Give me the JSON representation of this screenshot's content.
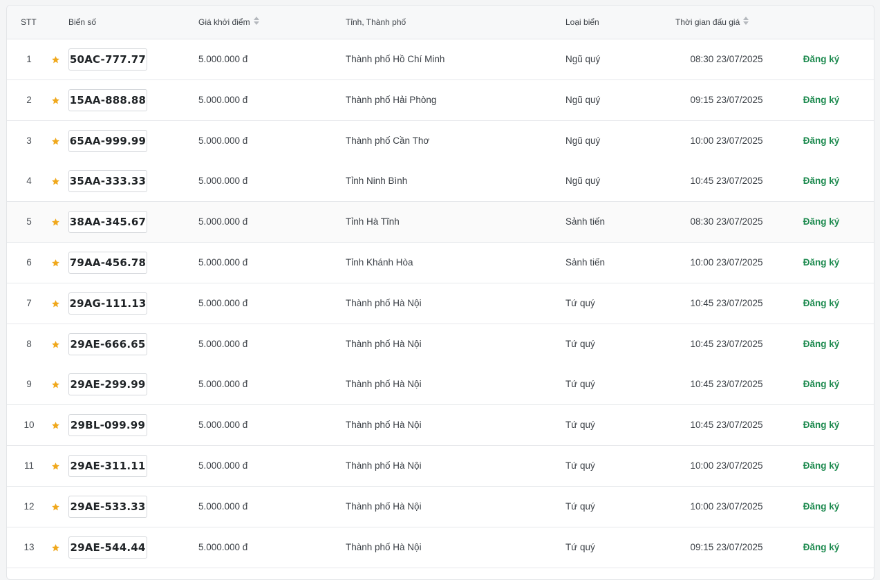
{
  "header": {
    "stt": "STT",
    "plate": "Biển số",
    "price": "Giá khởi điểm",
    "province": "Tỉnh, Thành phố",
    "type": "Loại biển",
    "time": "Thời gian đấu giá"
  },
  "accent_colors": {
    "star": "#f0a81c",
    "register": "#1d8a4f"
  },
  "rows": [
    {
      "stt": "1",
      "plate": "50AC-777.77",
      "price": "5.000.000 đ",
      "province": "Thành phố Hồ Chí Minh",
      "type": "Ngũ quý",
      "time": "08:30 23/07/2025",
      "action": "Đăng ký"
    },
    {
      "stt": "2",
      "plate": "15AA-888.88",
      "price": "5.000.000 đ",
      "province": "Thành phố Hải Phòng",
      "type": "Ngũ quý",
      "time": "09:15 23/07/2025",
      "action": "Đăng ký"
    },
    {
      "stt": "3",
      "plate": "65AA-999.99",
      "price": "5.000.000 đ",
      "province": "Thành phố Cần Thơ",
      "type": "Ngũ quý",
      "time": "10:00 23/07/2025",
      "action": "Đăng ký"
    },
    {
      "stt": "4",
      "plate": "35AA-333.33",
      "price": "5.000.000 đ",
      "province": "Tỉnh Ninh Bình",
      "type": "Ngũ quý",
      "time": "10:45 23/07/2025",
      "action": "Đăng ký"
    },
    {
      "stt": "5",
      "plate": "38AA-345.67",
      "price": "5.000.000 đ",
      "province": "Tỉnh Hà Tĩnh",
      "type": "Sảnh tiến",
      "time": "08:30 23/07/2025",
      "action": "Đăng ký"
    },
    {
      "stt": "6",
      "plate": "79AA-456.78",
      "price": "5.000.000 đ",
      "province": "Tỉnh Khánh Hòa",
      "type": "Sảnh tiến",
      "time": "10:00 23/07/2025",
      "action": "Đăng ký"
    },
    {
      "stt": "7",
      "plate": "29AG-111.13",
      "price": "5.000.000 đ",
      "province": "Thành phố Hà Nội",
      "type": "Tứ quý",
      "time": "10:45 23/07/2025",
      "action": "Đăng ký"
    },
    {
      "stt": "8",
      "plate": "29AE-666.65",
      "price": "5.000.000 đ",
      "province": "Thành phố Hà Nội",
      "type": "Tứ quý",
      "time": "10:45 23/07/2025",
      "action": "Đăng ký"
    },
    {
      "stt": "9",
      "plate": "29AE-299.99",
      "price": "5.000.000 đ",
      "province": "Thành phố Hà Nội",
      "type": "Tứ quý",
      "time": "10:45 23/07/2025",
      "action": "Đăng ký"
    },
    {
      "stt": "10",
      "plate": "29BL-099.99",
      "price": "5.000.000 đ",
      "province": "Thành phố Hà Nội",
      "type": "Tứ quý",
      "time": "10:45 23/07/2025",
      "action": "Đăng ký"
    },
    {
      "stt": "11",
      "plate": "29AE-311.11",
      "price": "5.000.000 đ",
      "province": "Thành phố Hà Nội",
      "type": "Tứ quý",
      "time": "10:00 23/07/2025",
      "action": "Đăng ký"
    },
    {
      "stt": "12",
      "plate": "29AE-533.33",
      "price": "5.000.000 đ",
      "province": "Thành phố Hà Nội",
      "type": "Tứ quý",
      "time": "10:00 23/07/2025",
      "action": "Đăng ký"
    },
    {
      "stt": "13",
      "plate": "29AE-544.44",
      "price": "5.000.000 đ",
      "province": "Thành phố Hà Nội",
      "type": "Tứ quý",
      "time": "09:15 23/07/2025",
      "action": "Đăng ký"
    }
  ]
}
